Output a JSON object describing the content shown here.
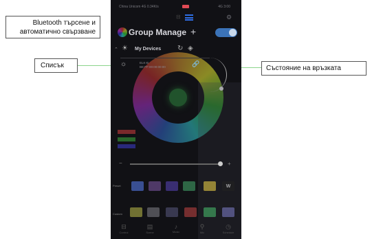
{
  "callouts": {
    "bluetooth": "Bluetooth търсене и автоматично свързване",
    "list": "Списък",
    "status": "Състояние на връзката"
  },
  "phone": {
    "statusbar_left": "China Unicom 4G 0.34K/s",
    "statusbar_right": "4G 3:00",
    "header": {
      "title": "Group Manage",
      "plus": "+"
    },
    "toggle_on": true,
    "devices_label": "My Devices",
    "device": {
      "name": "ELK-B",
      "mac": "BE:FF:00:00:00:00"
    },
    "color_center": "#2f8a3f",
    "rgb_bars": [
      "#c23a3a",
      "#3aa23a",
      "#3a3ac2"
    ],
    "row1_label": "Preset",
    "row1_colors": [
      "#4a6ac8",
      "#6a4a8a",
      "#4a3a9a",
      "#3a8a5a",
      "#c8b040"
    ],
    "row1_w": "W",
    "row2_label": "Custom",
    "row2_colors": [
      "#9a9a40",
      "#6a6a70",
      "#4a4a6a",
      "#a03a3a",
      "#40a060",
      "#6a6aa8"
    ],
    "nav": [
      {
        "icon": "⊟",
        "label": "Control"
      },
      {
        "icon": "▤",
        "label": "Scene"
      },
      {
        "icon": "♪",
        "label": "Music"
      },
      {
        "icon": "⚲",
        "label": "Mic"
      },
      {
        "icon": "◷",
        "label": "Schedule"
      }
    ]
  }
}
